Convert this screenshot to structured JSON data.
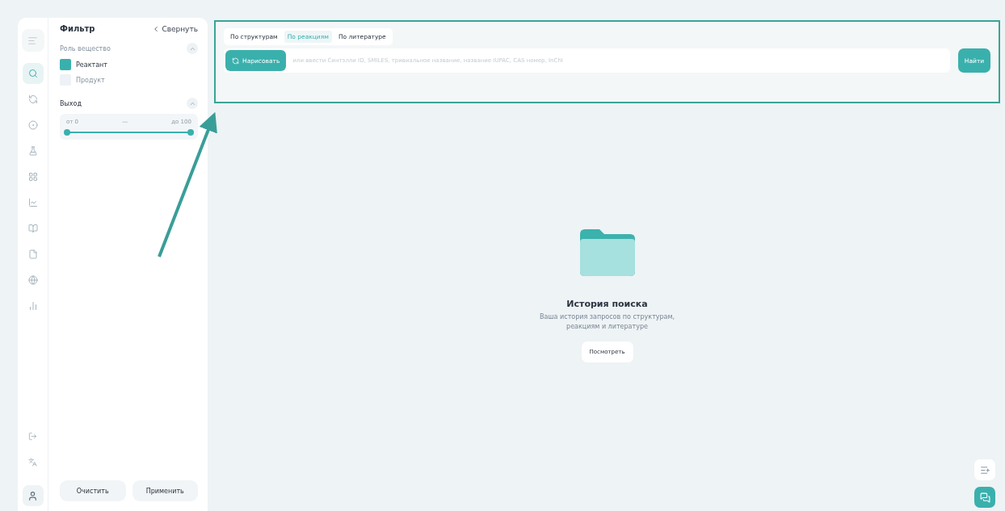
{
  "nav": {
    "items": [
      {
        "kind": "search",
        "selected": true
      },
      {
        "kind": "reaction",
        "selected": false
      },
      {
        "kind": "ring",
        "selected": false
      },
      {
        "kind": "flask",
        "selected": false
      },
      {
        "kind": "grid",
        "selected": false
      },
      {
        "kind": "chart",
        "selected": false
      },
      {
        "kind": "book",
        "selected": false
      },
      {
        "kind": "file",
        "selected": false
      },
      {
        "kind": "globe",
        "selected": false
      },
      {
        "kind": "bars",
        "selected": false
      }
    ]
  },
  "filter": {
    "title": "Фильтр",
    "collapse": "Свернуть",
    "sections": [
      {
        "kind": "checks",
        "title": "Роль вещество",
        "expanded": true,
        "options": [
          {
            "label": "Реактант",
            "checked": true
          },
          {
            "label": "Продукт",
            "checked": false
          }
        ]
      },
      {
        "kind": "range",
        "title": "Выход",
        "expanded": true,
        "from": "от 0",
        "dash": "—",
        "to": "до 100",
        "level": 1
      }
    ],
    "buttons": [
      "Очистить",
      "Применить"
    ]
  },
  "search": {
    "tabs": [
      {
        "label": "По структурам",
        "selected": false
      },
      {
        "label": "По реакциям",
        "selected": true
      },
      {
        "label": "По литературе",
        "selected": false
      }
    ],
    "draw_button": "Нарисовать",
    "placeholder": "или ввести Синтэлли ID, SMILES, тривиальное название, название IUPAC, CAS номер, InChI",
    "find_button": "Найти"
  },
  "history": {
    "title": "История поиска",
    "text": "Ваша история запросов по структурам, реакциям и литературе",
    "button": "Посмотреть"
  }
}
